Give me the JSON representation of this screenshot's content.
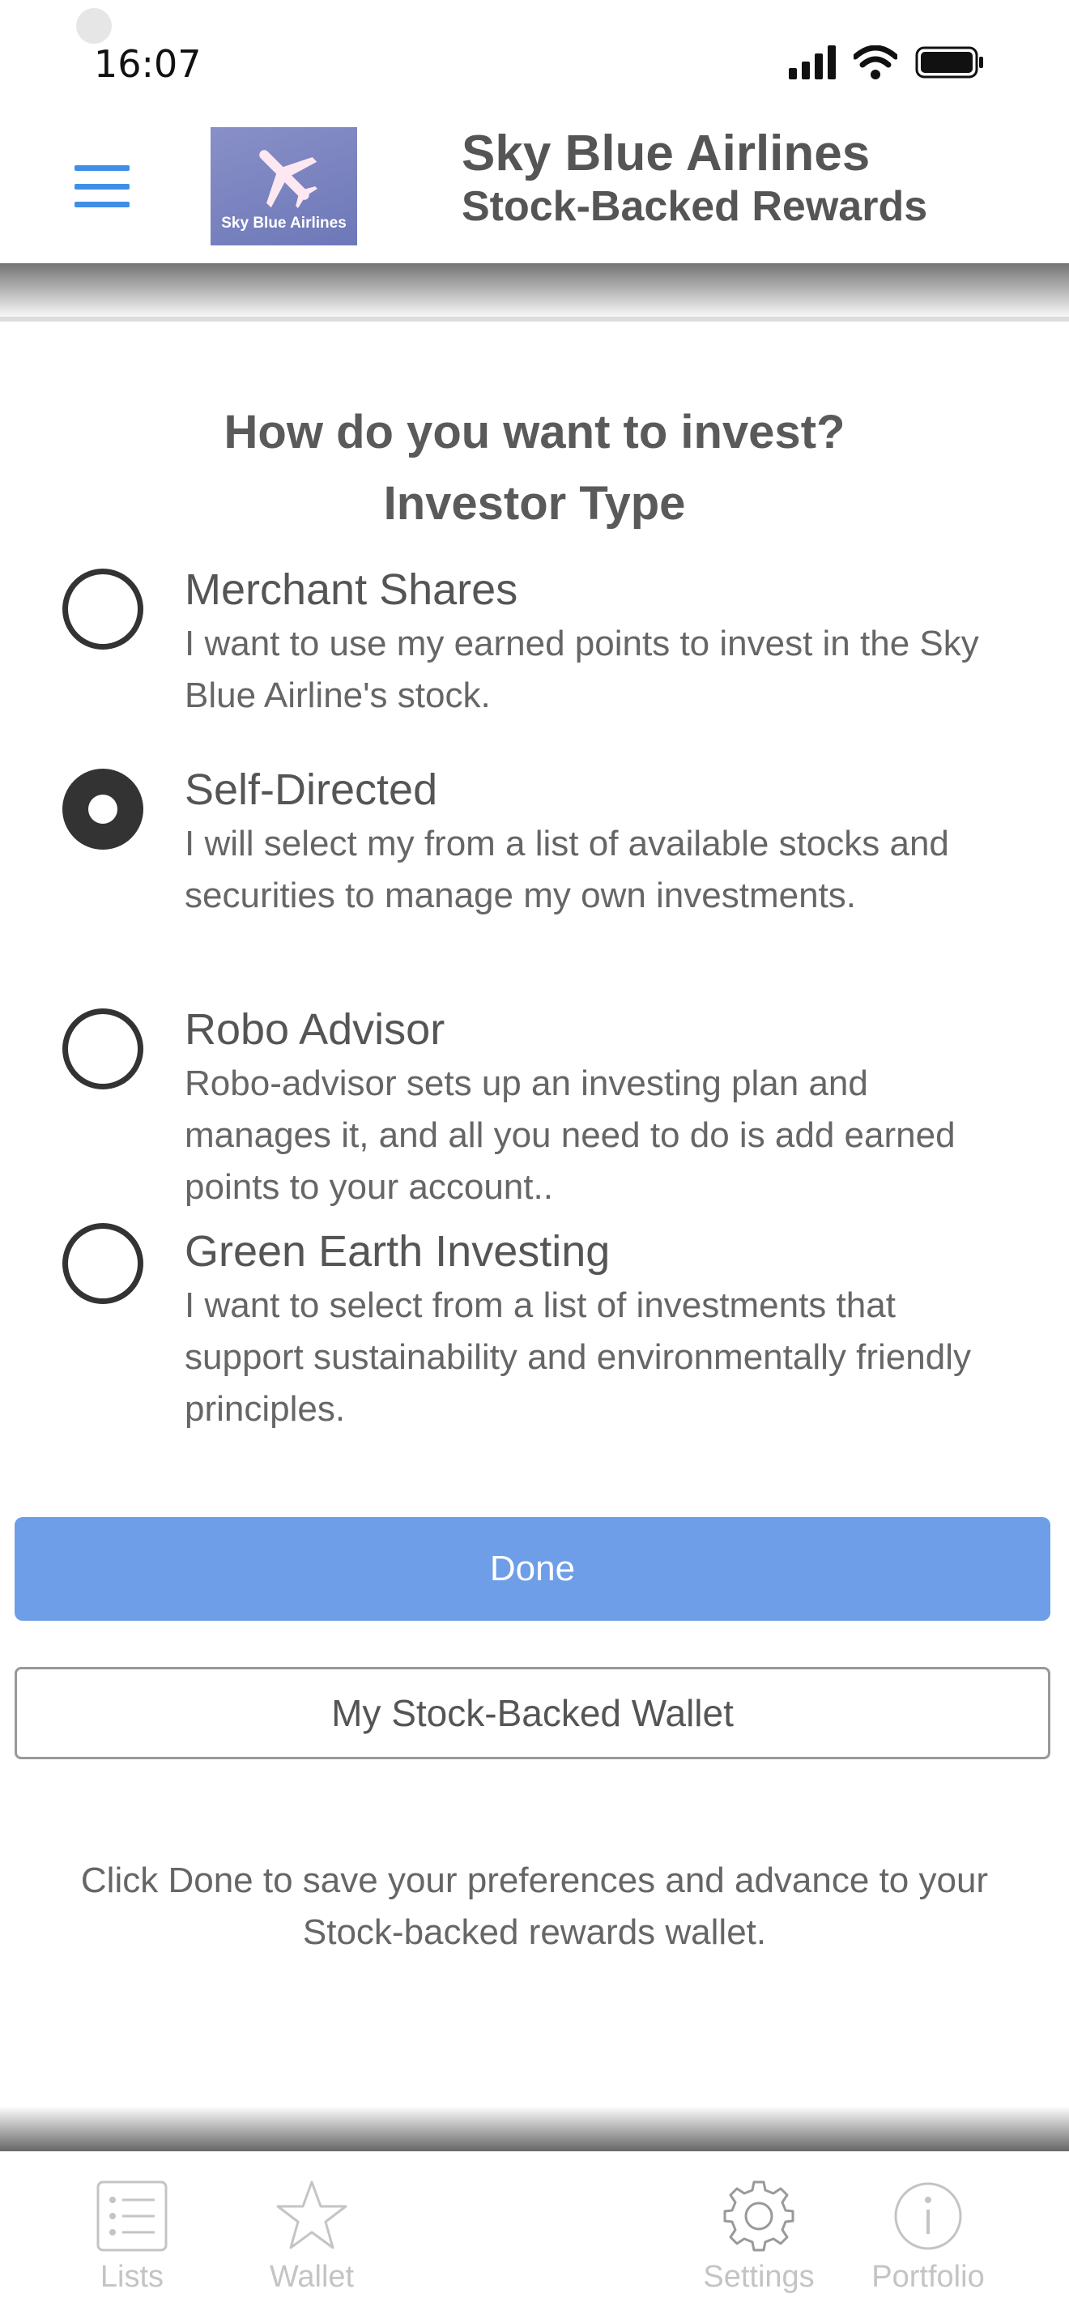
{
  "status_bar": {
    "time": "16:07"
  },
  "header": {
    "title": "Sky Blue Airlines",
    "subtitle": "Stock-Backed Rewards",
    "logo_text": "Sky Blue Airlines",
    "accent_color": "#3f8fe8"
  },
  "main": {
    "question": "How do you want to invest?",
    "section_title": "Investor Type",
    "options": [
      {
        "title": "Merchant Shares",
        "description": "I want to use my earned points to invest in the Sky Blue Airline's stock.",
        "selected": false
      },
      {
        "title": "Self-Directed",
        "description": "I will select my from a list of available stocks and securities to manage my own investments.",
        "selected": true
      },
      {
        "title": "Robo Advisor",
        "description": "Robo-advisor sets up an investing plan and manages it, and all you need to do is add earned points to your account..",
        "selected": false
      },
      {
        "title": "Green Earth Investing",
        "description": "I want to select from a list of investments that support sustainability and environmentally friendly principles.",
        "selected": false
      }
    ],
    "done_label": "Done",
    "wallet_label": "My Stock-Backed Wallet",
    "footer_note": "Click Done to save your preferences and advance to your Stock-backed rewards wallet.",
    "done_color": "#6e9ee8"
  },
  "tab_bar": {
    "tabs": [
      {
        "label": "Lists",
        "icon": "list-icon"
      },
      {
        "label": "Wallet",
        "icon": "star-icon"
      },
      {
        "label": "Settings",
        "icon": "gear-icon"
      },
      {
        "label": "Portfolio",
        "icon": "info-icon"
      }
    ]
  }
}
